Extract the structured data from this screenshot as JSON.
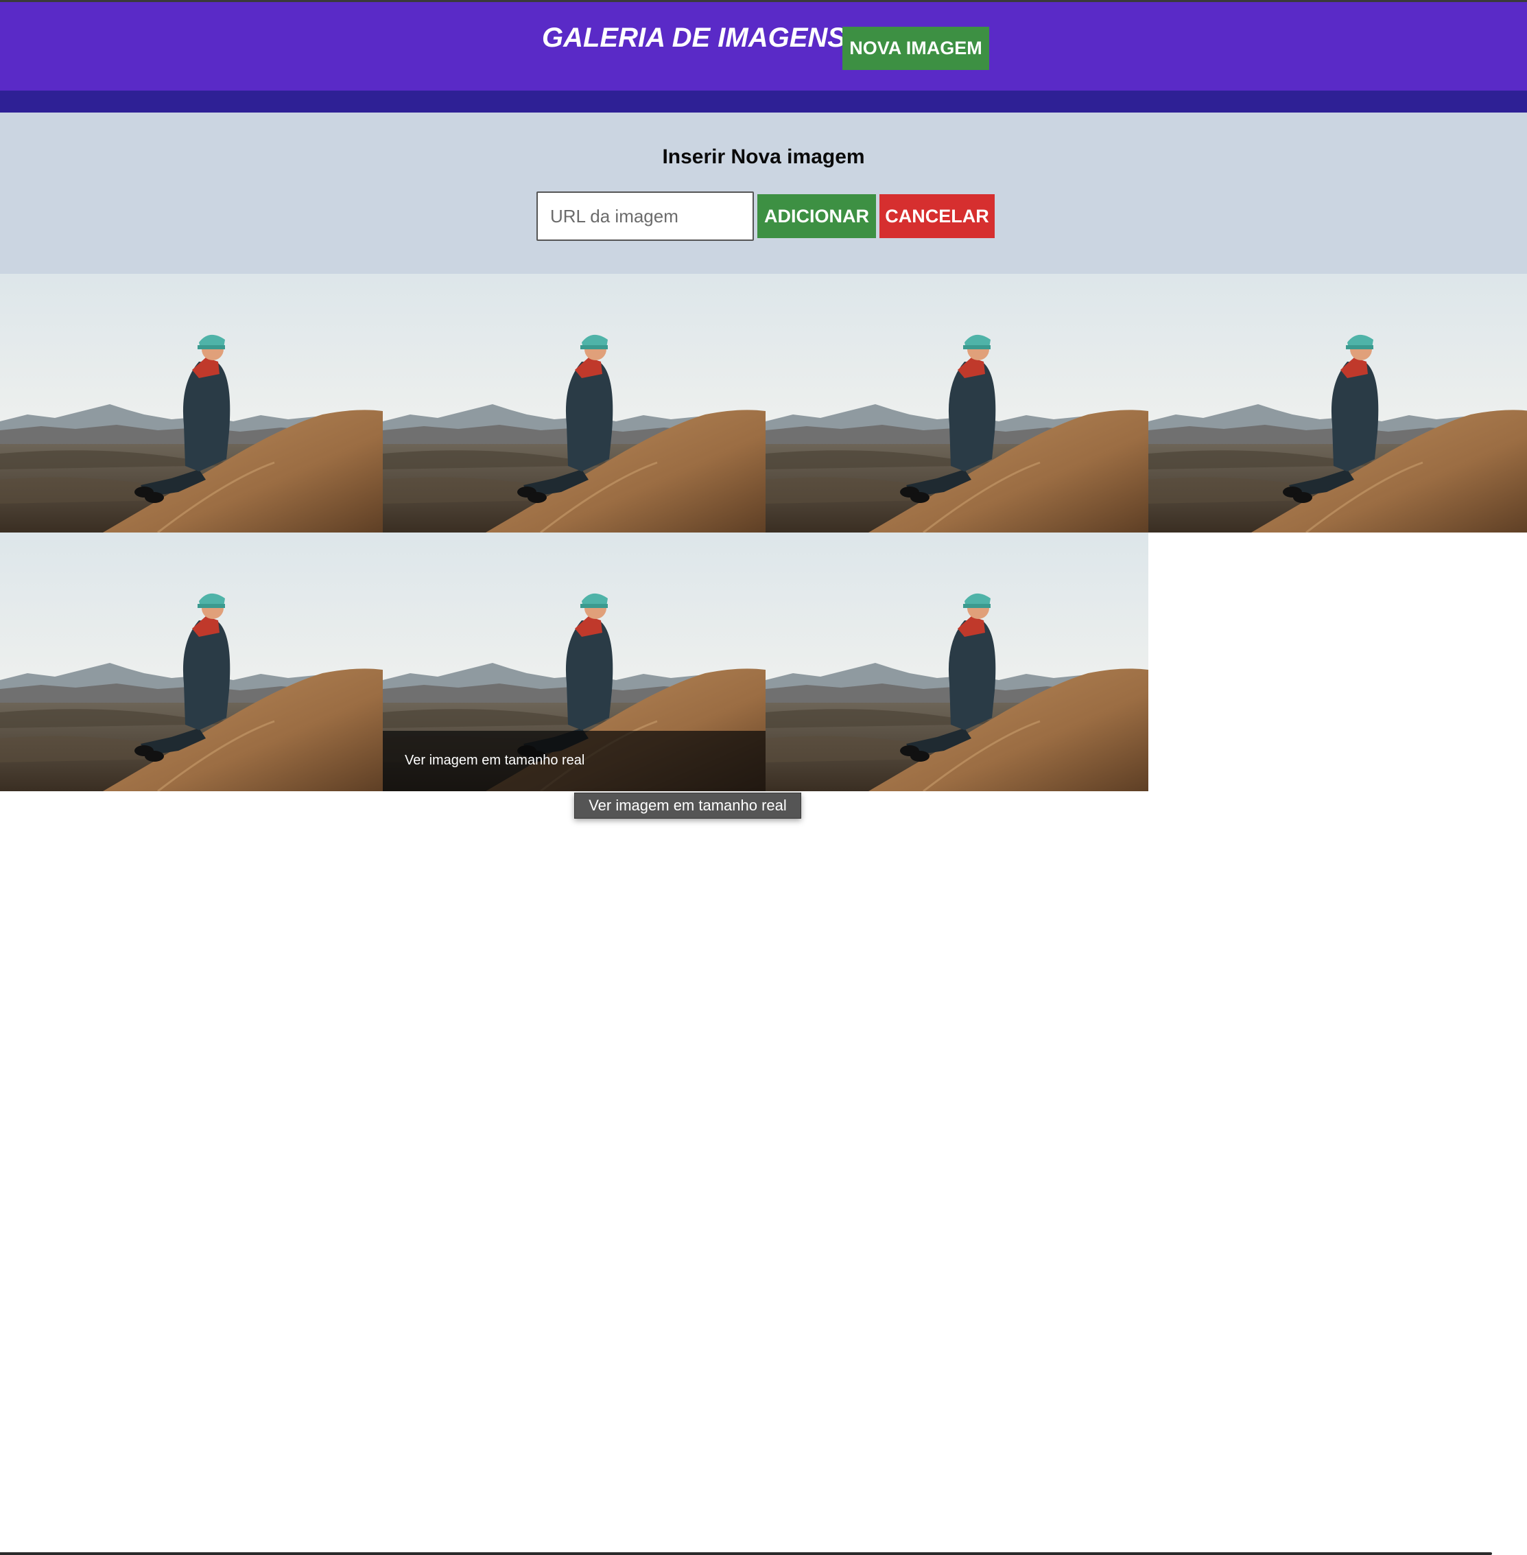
{
  "header": {
    "title": "GALERIA DE IMAGENS",
    "new_image_button": "NOVA IMAGEM"
  },
  "form": {
    "title": "Inserir Nova imagem",
    "url_placeholder": "URL da imagem",
    "url_value": "",
    "add_button": "ADICIONAR",
    "cancel_button": "CANCELAR"
  },
  "gallery": {
    "image_count": 7,
    "hover_caption": "Ver imagem em tamanho real",
    "tooltip": "Ver imagem em tamanho real"
  },
  "colors": {
    "header_bg": "#5a2ac7",
    "subbar_bg": "#2e2095",
    "form_bg": "#cbd5e1",
    "success": "#3d9043",
    "danger": "#d62f2f"
  }
}
